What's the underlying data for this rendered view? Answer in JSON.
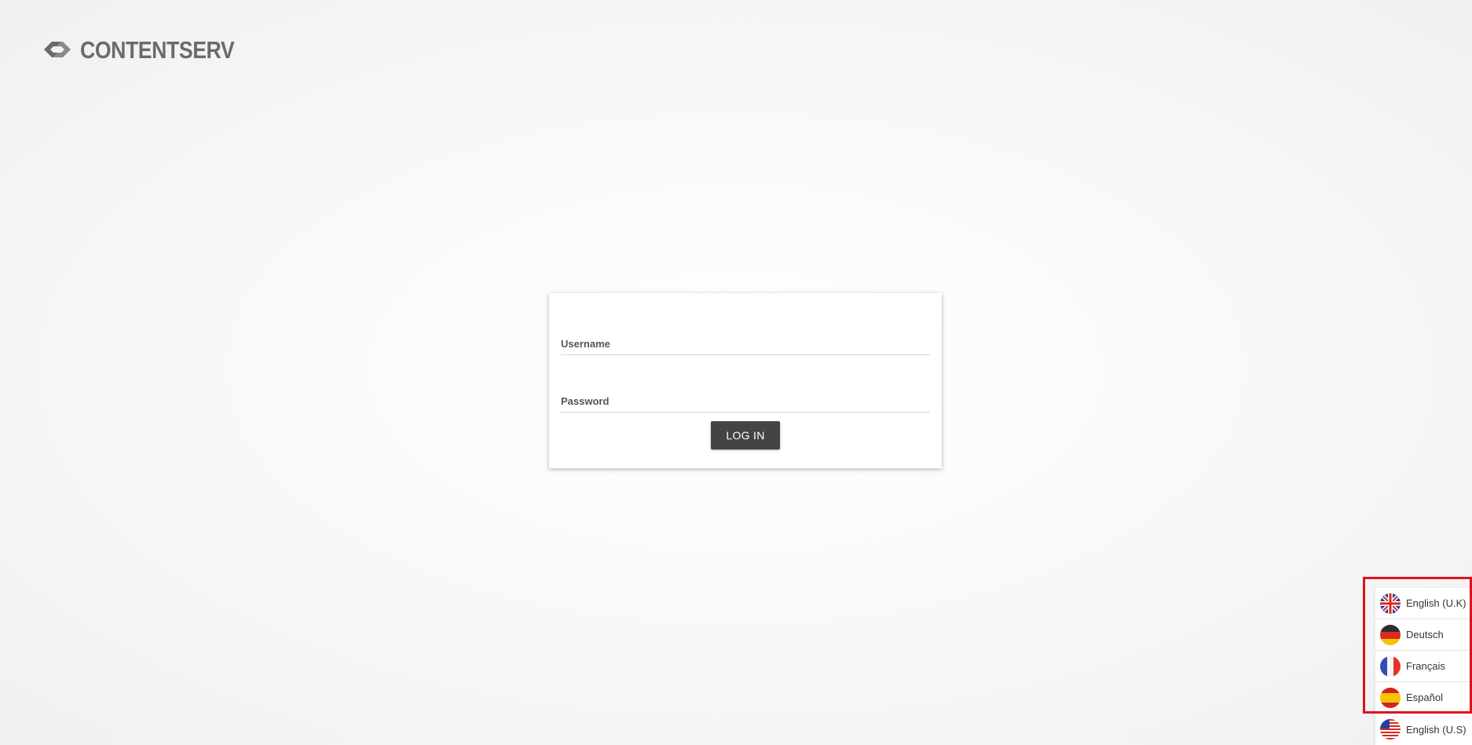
{
  "logo": {
    "text": "CONTENTSERV",
    "icon": "contentserv-logo-icon"
  },
  "login": {
    "username_label": "Username",
    "username_value": "",
    "password_label": "Password",
    "password_value": "",
    "button_label": "LOG IN"
  },
  "languages": {
    "items": [
      {
        "label": "English (U.K)",
        "icon": "uk-flag-icon"
      },
      {
        "label": "Deutsch",
        "icon": "germany-flag-icon"
      },
      {
        "label": "Français",
        "icon": "france-flag-icon"
      },
      {
        "label": "Español",
        "icon": "spain-flag-icon"
      },
      {
        "label": "English (U.S)",
        "icon": "us-flag-icon"
      }
    ],
    "highlight_color": "#e0101e"
  },
  "colors": {
    "button_bg": "#444444",
    "logo_gray": "#6b6b6b"
  }
}
